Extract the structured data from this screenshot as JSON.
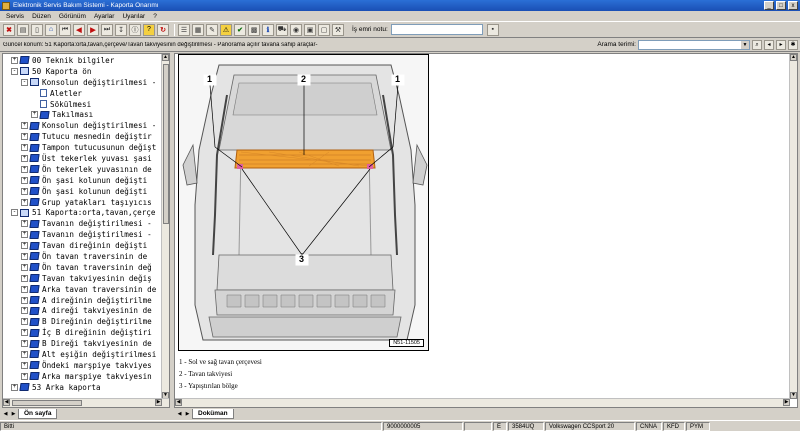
{
  "window": {
    "title": "Elektronik Servis Bakım Sistemi  -  Kaporta Onarımı",
    "minimize_glyph": "_",
    "maximize_glyph": "□",
    "close_glyph": "x"
  },
  "menu": [
    "Servis",
    "Düzen",
    "Görünüm",
    "Ayarlar",
    "Uyarılar",
    "?"
  ],
  "toolbar": {
    "workorder_label": "İş emri notu:",
    "workorder_value": ""
  },
  "pathbar": {
    "path": "Güncel konum: 51 Kaporta:orta,tavan,çerçeve/Tavan takviyesinin değiştirilmesi - Panorama açılır tavana sahip araçlar-",
    "search_label": "Arama terimi:",
    "search_value": ""
  },
  "tree": [
    {
      "level": 1,
      "exp": "+",
      "icon": "book",
      "label": "00 Teknik bilgiler"
    },
    {
      "level": 1,
      "exp": "-",
      "icon": "openbook",
      "label": "50 Kaporta ön"
    },
    {
      "level": 2,
      "exp": "-",
      "icon": "openbook",
      "label": "Konsolun değiştirilmesi -"
    },
    {
      "level": 3,
      "exp": "",
      "icon": "doc",
      "label": "Aletler"
    },
    {
      "level": 3,
      "exp": "",
      "icon": "doc",
      "label": "Sökülmesi"
    },
    {
      "level": 3,
      "exp": "+",
      "icon": "book",
      "label": "Takılması"
    },
    {
      "level": 2,
      "exp": "+",
      "icon": "book",
      "label": "Konsolun değiştirilmesi -"
    },
    {
      "level": 2,
      "exp": "+",
      "icon": "book",
      "label": "Tutucu mesnedin değiştir"
    },
    {
      "level": 2,
      "exp": "+",
      "icon": "book",
      "label": "Tampon tutucusunun değişt"
    },
    {
      "level": 2,
      "exp": "+",
      "icon": "book",
      "label": "Üst tekerlek yuvası şasi"
    },
    {
      "level": 2,
      "exp": "+",
      "icon": "book",
      "label": "Ön tekerlek yuvasının de"
    },
    {
      "level": 2,
      "exp": "+",
      "icon": "book",
      "label": "Ön şasi kolunun değişti"
    },
    {
      "level": 2,
      "exp": "+",
      "icon": "book",
      "label": "Ön şasi kolunun değişti"
    },
    {
      "level": 2,
      "exp": "+",
      "icon": "book",
      "label": "Grup yatakları taşıyıcıs"
    },
    {
      "level": 1,
      "exp": "-",
      "icon": "openbook",
      "label": "51 Kaporta:orta,tavan,çerçe"
    },
    {
      "level": 2,
      "exp": "+",
      "icon": "book",
      "label": "Tavanın değiştirilmesi -"
    },
    {
      "level": 2,
      "exp": "+",
      "icon": "book",
      "label": "Tavanın değiştirilmesi -"
    },
    {
      "level": 2,
      "exp": "+",
      "icon": "book",
      "label": "Tavan direğinin değişti"
    },
    {
      "level": 2,
      "exp": "+",
      "icon": "book",
      "label": "Ön tavan traversinin de"
    },
    {
      "level": 2,
      "exp": "+",
      "icon": "book",
      "label": "Ön tavan traversinin değ"
    },
    {
      "level": 2,
      "exp": "+",
      "icon": "book",
      "label": "Tavan takviyesinin değiş"
    },
    {
      "level": 2,
      "exp": "+",
      "icon": "book",
      "label": "Arka tavan traversinin de"
    },
    {
      "level": 2,
      "exp": "+",
      "icon": "book",
      "label": "A direğinin değiştirilme"
    },
    {
      "level": 2,
      "exp": "+",
      "icon": "book",
      "label": "A direği takviyesinin de"
    },
    {
      "level": 2,
      "exp": "+",
      "icon": "book",
      "label": "B Direğinin değiştirilme"
    },
    {
      "level": 2,
      "exp": "+",
      "icon": "book",
      "label": "İç B direğinin değiştiri"
    },
    {
      "level": 2,
      "exp": "+",
      "icon": "book",
      "label": "B Direği takviyesinin de"
    },
    {
      "level": 2,
      "exp": "+",
      "icon": "book",
      "label": "Alt eşiğin değiştirilmesi"
    },
    {
      "level": 2,
      "exp": "+",
      "icon": "book",
      "label": "Öndeki marşpiye takviyes"
    },
    {
      "level": 2,
      "exp": "+",
      "icon": "book",
      "label": "Arka marşpiye takviyesin"
    },
    {
      "level": 1,
      "exp": "+",
      "icon": "book",
      "label": "53 Arka kaporta"
    }
  ],
  "tabs": {
    "left": "Ön sayfa",
    "right": "Doküman"
  },
  "figure": {
    "code": "N51-11505",
    "callouts": [
      "1",
      "2",
      "1",
      "3"
    ]
  },
  "legend": [
    "1 -  Sol ve sağ tavan çerçevesi",
    "2 -  Tavan takviyesi",
    "3 -  Yapıştırılan bölge"
  ],
  "status": [
    "Bitti",
    "9000000005",
    "3584UQ",
    "Volkswagen CCSport 20",
    "CNNA",
    "KFD",
    "PYM"
  ],
  "colors": {
    "titlebar": "#1a4fb4",
    "highlight": "#f0a030",
    "glue_mark": "#e060a0"
  }
}
